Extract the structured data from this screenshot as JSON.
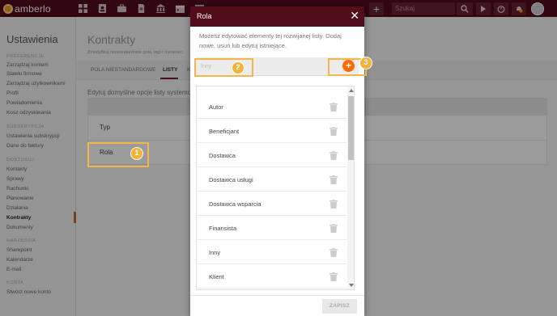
{
  "topbar": {
    "logo_text": "amberlo",
    "plus_label": "+",
    "search_placeholder": "Szukaj wszystkiego...",
    "nav_icons": [
      "dashboard-icon",
      "contacts-icon",
      "briefcase-icon",
      "document-icon",
      "bank-icon",
      "calendar-icon",
      "list-icon"
    ],
    "right_icons": [
      "play-icon",
      "timer-icon",
      "bell-icon"
    ]
  },
  "sidebar": {
    "title": "Ustawienia",
    "sections": [
      {
        "heading": "PREFERENCJE",
        "items": [
          "Zarządzaj kontem",
          "Stawki firmowe",
          "Zarządzaj użytkownikami",
          "Profil",
          "Powiadomienia",
          "Kosz odzyskiwania"
        ]
      },
      {
        "heading": "SUBSKRYPCJA",
        "items": [
          "Ustawienia subskrypcji",
          "Dane do faktury"
        ]
      },
      {
        "heading": "DOSTOSUJ",
        "items": [
          "Kontakty",
          "Sprawy",
          "Rachunki",
          "Planowanie",
          "Działania",
          "Kontrakty",
          "Dokumenty"
        ]
      },
      {
        "heading": "NARZĘDZIA",
        "items": [
          "Sharepoint",
          "Kalendarze",
          "E-mail"
        ]
      },
      {
        "heading": "KONTA",
        "items": [
          "Stwórz nowe konto"
        ]
      }
    ],
    "active_item": "Kontrakty"
  },
  "main": {
    "title": "Kontrakty",
    "subtitle": "Zmodyfikuj niestandardowe pola, tagi i numeracj",
    "tabs": [
      {
        "label": "POLA NIESTANDARDOWE",
        "active": false
      },
      {
        "label": "LISTY",
        "active": true
      },
      {
        "label": "K",
        "active": false
      }
    ],
    "list_title": "Edytuj domyślne opcje listy systemo",
    "rows": [
      "Typ",
      "Rola"
    ]
  },
  "modal": {
    "title": "Rola",
    "close_label": "✕",
    "description": "Możesz edytować elementy tej rozwijanej listy. Dodaj nowe, usuń lub edytuj istniejące.",
    "new_input_placeholder": "Inny",
    "add_label": "+",
    "options": [
      "Autor",
      "Beneficjant",
      "Dostawca",
      "Dostawca usługi",
      "Dostawca wsparcia",
      "Finansista",
      "Inny",
      "Klient"
    ],
    "save_label": "ZAPISZ"
  },
  "callouts": [
    {
      "number": "1",
      "target": "Rola row"
    },
    {
      "number": "2",
      "target": "new option input"
    },
    {
      "number": "3",
      "target": "add button"
    }
  ],
  "colors": {
    "header": "#520c1a",
    "accent_orange": "#ff6a00",
    "callout": "#f3b23a"
  }
}
